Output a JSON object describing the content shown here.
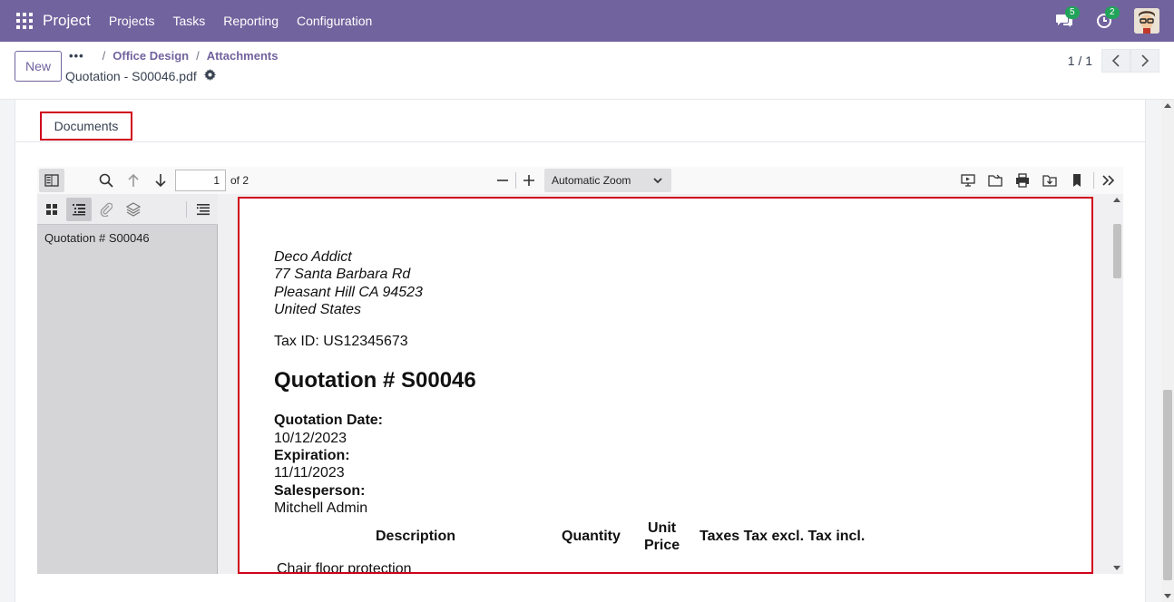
{
  "navbar": {
    "brand": "Project",
    "menu": [
      "Projects",
      "Tasks",
      "Reporting",
      "Configuration"
    ],
    "messages_count": "5",
    "activities_count": "2"
  },
  "control": {
    "new_label": "New",
    "breadcrumb_dots": "•••",
    "breadcrumb": [
      "Office Design",
      "Attachments"
    ],
    "record_title": "Quotation - S00046.pdf",
    "pager": "1 / 1"
  },
  "tabs": {
    "documents": "Documents"
  },
  "viewer": {
    "page_number": "1",
    "page_total": "of 2",
    "zoom": "Automatic Zoom",
    "outline_item": "Quotation # S00046"
  },
  "pdf": {
    "address": [
      "Deco Addict",
      "77 Santa Barbara Rd",
      "Pleasant Hill CA 94523",
      "United States"
    ],
    "tax_id": "Tax ID: US12345673",
    "title": "Quotation # S00046",
    "quotation_date_label": "Quotation Date:",
    "quotation_date": "10/12/2023",
    "expiration_label": "Expiration:",
    "expiration": "11/11/2023",
    "salesperson_label": "Salesperson:",
    "salesperson": "Mitchell Admin",
    "table_headers": {
      "description": "Description",
      "quantity": "Quantity",
      "unit": "Unit",
      "price": "Price",
      "taxes_row": "Taxes Tax excl. Tax incl."
    },
    "first_row": "Chair floor protection"
  },
  "colors": {
    "navbar": "#71639e",
    "highlight": "#d0021b",
    "badge": "#22a35a"
  }
}
